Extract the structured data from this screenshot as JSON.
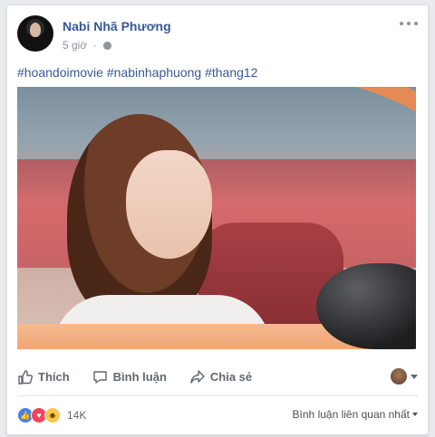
{
  "post": {
    "author": "Nabi Nhã Phương",
    "time": "5 giờ",
    "separator": "·",
    "hashtags": "#hoandoimovie #nabinhaphuong #thang12"
  },
  "actions": {
    "like_label": "Thích",
    "comment_label": "Bình luận",
    "share_label": "Chia sẻ"
  },
  "reactions": {
    "count": "14K",
    "types": [
      "like",
      "love",
      "haha"
    ]
  },
  "comments": {
    "sort_label": "Bình luận liên quan nhất"
  },
  "colors": {
    "link": "#365899",
    "muted": "#90949c",
    "background": "#e9ebee"
  }
}
